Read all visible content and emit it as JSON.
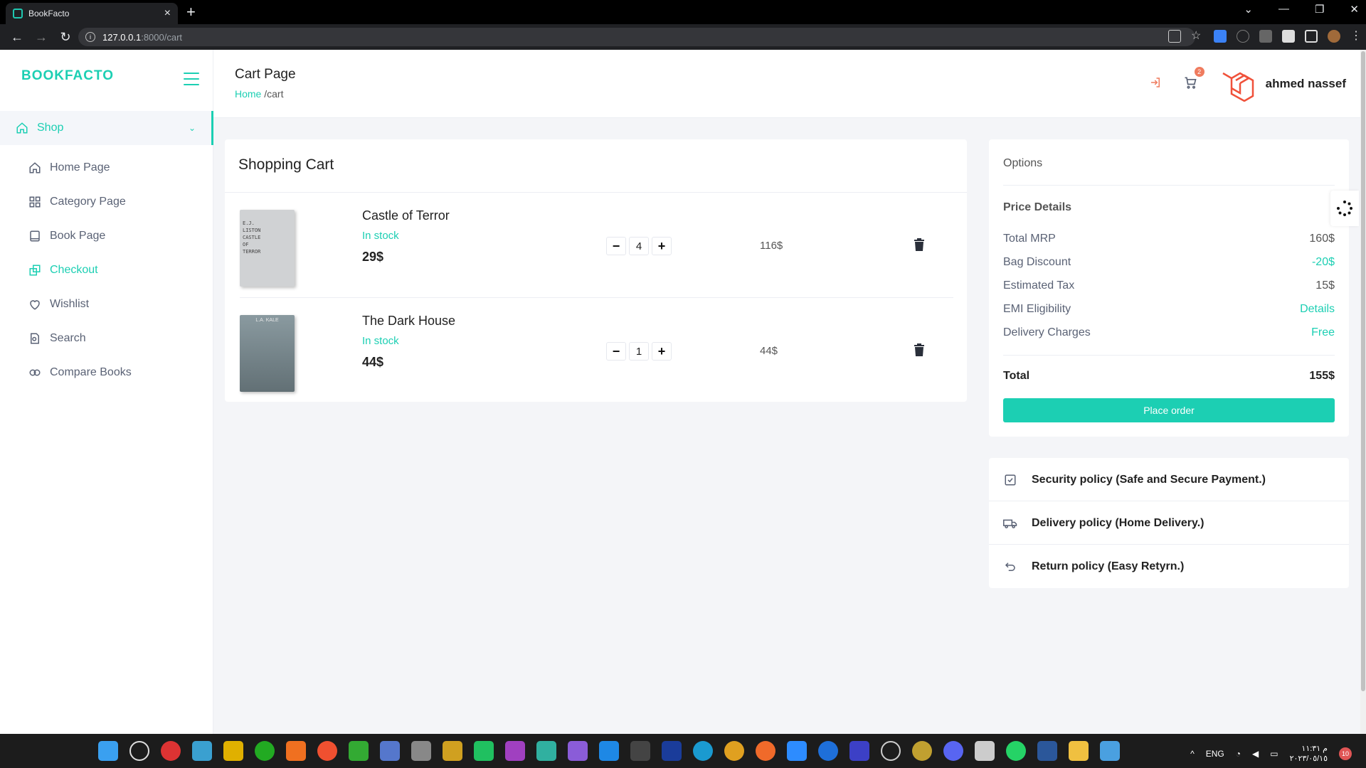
{
  "browser": {
    "tab_title": "BookFacto",
    "url_host": "127.0.0.1",
    "url_path": ":8000/cart"
  },
  "sidebar": {
    "brand": "BOOKFACTO",
    "section": "Shop",
    "items": [
      {
        "label": "Home Page",
        "icon": "home-icon",
        "active": false
      },
      {
        "label": "Category Page",
        "icon": "grid-icon",
        "active": false
      },
      {
        "label": "Book Page",
        "icon": "book-icon",
        "active": false
      },
      {
        "label": "Checkout",
        "icon": "copy-icon",
        "active": true
      },
      {
        "label": "Wishlist",
        "icon": "heart-icon",
        "active": false
      },
      {
        "label": "Search",
        "icon": "file-search-icon",
        "active": false
      },
      {
        "label": "Compare Books",
        "icon": "compare-icon",
        "active": false
      }
    ]
  },
  "header": {
    "title": "Cart Page",
    "breadcrumb_home": "Home",
    "breadcrumb_current": " /cart",
    "cart_count": "2",
    "user_name": "ahmed nassef"
  },
  "cart": {
    "title": "Shopping Cart",
    "items": [
      {
        "name": "Castle of Terror",
        "stock": "In stock",
        "price": "29$",
        "qty": "4",
        "subtotal": "116$",
        "cover_text": "E.J.\nLISTON\nCASTLE\nOF\nTERROR"
      },
      {
        "name": "The Dark House",
        "stock": "In stock",
        "price": "44$",
        "qty": "1",
        "subtotal": "44$",
        "cover_text": "L.A. KALE"
      }
    ]
  },
  "options": {
    "title": "Options",
    "price_details_title": "Price Details",
    "rows": [
      {
        "label": "Total MRP",
        "value": "160$"
      },
      {
        "label": "Bag Discount",
        "value": "-20$"
      },
      {
        "label": "Estimated Tax",
        "value": "15$"
      },
      {
        "label": "EMI Eligibility",
        "value": "Details"
      },
      {
        "label": "Delivery Charges",
        "value": "Free"
      }
    ],
    "total_label": "Total",
    "total_value": "155$",
    "place_order": "Place order"
  },
  "policies": [
    {
      "label": "Security policy (Safe and Secure Payment.)",
      "icon": "check-square-icon"
    },
    {
      "label": "Delivery policy (Home Delivery.)",
      "icon": "truck-icon"
    },
    {
      "label": "Return policy (Easy Retyrn.)",
      "icon": "undo-icon"
    }
  ],
  "taskbar": {
    "lang": "ENG",
    "time": "م ١١:٣١",
    "date": "٢٠٢٣/٠٥/١٥",
    "notifications": "10"
  },
  "colors": {
    "accent": "#1ccfb3",
    "logout": "#ef7b5e"
  }
}
